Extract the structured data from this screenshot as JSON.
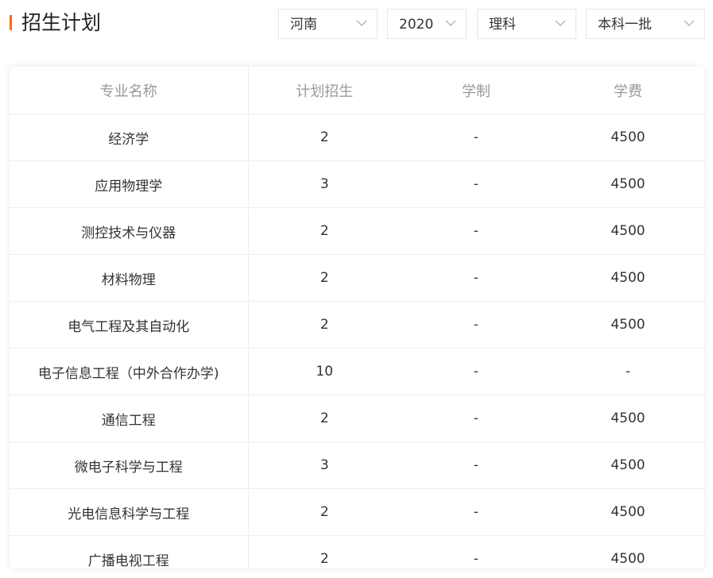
{
  "header": {
    "title": "招生计划",
    "accent_color": "#ff6a00",
    "filters": [
      {
        "value": "河南",
        "icon": "chevron-down-icon"
      },
      {
        "value": "2020",
        "icon": "chevron-down-icon"
      },
      {
        "value": "理科",
        "icon": "chevron-down-icon"
      },
      {
        "value": "本科一批",
        "icon": "chevron-down-icon"
      }
    ]
  },
  "table": {
    "columns": [
      "专业名称",
      "计划招生",
      "学制",
      "学费"
    ],
    "rows": [
      [
        "经济学",
        "2",
        "-",
        "4500"
      ],
      [
        "应用物理学",
        "3",
        "-",
        "4500"
      ],
      [
        "测控技术与仪器",
        "2",
        "-",
        "4500"
      ],
      [
        "材料物理",
        "2",
        "-",
        "4500"
      ],
      [
        "电气工程及其自动化",
        "2",
        "-",
        "4500"
      ],
      [
        "电子信息工程（中外合作办学)",
        "10",
        "-",
        "-"
      ],
      [
        "通信工程",
        "2",
        "-",
        "4500"
      ],
      [
        "微电子科学与工程",
        "3",
        "-",
        "4500"
      ],
      [
        "光电信息科学与工程",
        "2",
        "-",
        "4500"
      ],
      [
        "广播电视工程",
        "2",
        "-",
        "4500"
      ]
    ]
  }
}
